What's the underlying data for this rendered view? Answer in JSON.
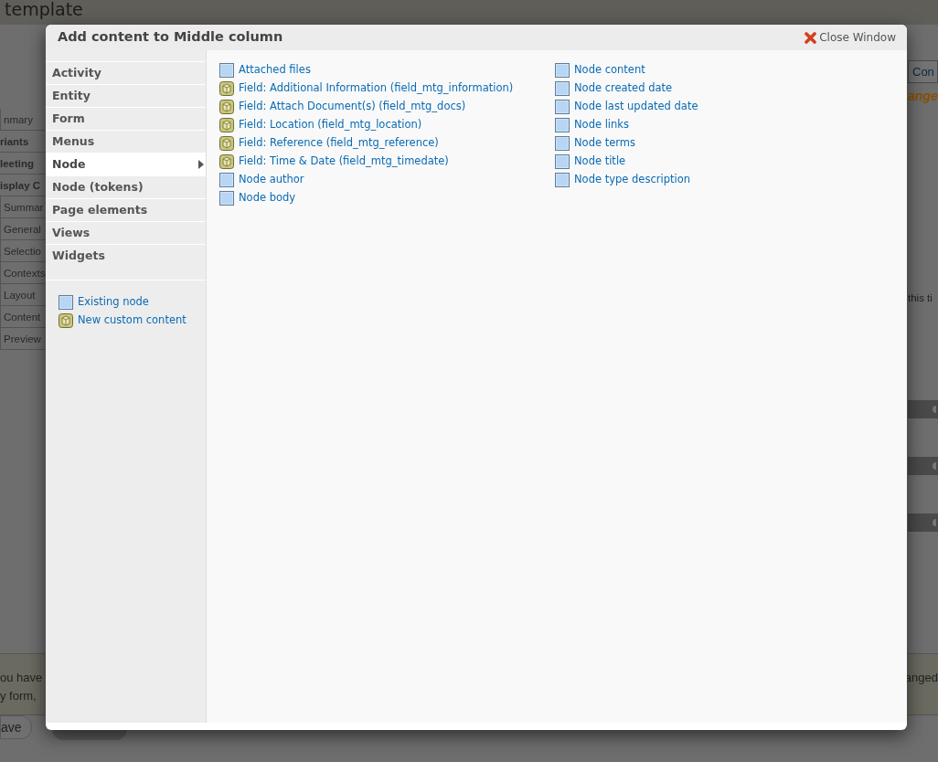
{
  "page": {
    "title": "template",
    "tabs": [
      {
        "label": "nmary",
        "kind": "tab"
      },
      {
        "label": "riants",
        "kind": "heading"
      },
      {
        "label": "leeting",
        "kind": "heading"
      },
      {
        "label": "isplay C",
        "kind": "heading"
      },
      {
        "label": "Summar",
        "kind": "tab"
      },
      {
        "label": "General",
        "kind": "tab"
      },
      {
        "label": "Selectio",
        "kind": "tab"
      },
      {
        "label": "Contexts",
        "kind": "tab"
      },
      {
        "label": "Layout",
        "kind": "tab"
      },
      {
        "label": "Content",
        "kind": "tab"
      },
      {
        "label": "Preview",
        "kind": "tab"
      }
    ],
    "right_button": "Con",
    "right_notice": "ange",
    "right_text": "this ti",
    "message_lines": [
      "ou have",
      "y form,"
    ],
    "message_right": "anged",
    "save_button": "ave"
  },
  "modal": {
    "title": "Add content to Middle column",
    "close": "Close Window",
    "categories": [
      {
        "label": "Activity",
        "selected": false
      },
      {
        "label": "Entity",
        "selected": false
      },
      {
        "label": "Form",
        "selected": false
      },
      {
        "label": "Menus",
        "selected": false
      },
      {
        "label": "Node",
        "selected": true
      },
      {
        "label": "Node (tokens)",
        "selected": false
      },
      {
        "label": "Page elements",
        "selected": false
      },
      {
        "label": "Views",
        "selected": false
      },
      {
        "label": "Widgets",
        "selected": false
      }
    ],
    "extra_links": [
      {
        "label": "Existing node",
        "kind": "page"
      },
      {
        "label": "New custom content",
        "kind": "box"
      }
    ],
    "columns": [
      [
        {
          "label": "Attached files",
          "kind": "page"
        },
        {
          "label": "Field: Additional Information (field_mtg_information)",
          "kind": "box"
        },
        {
          "label": "Field: Attach Document(s) (field_mtg_docs)",
          "kind": "box"
        },
        {
          "label": "Field: Location (field_mtg_location)",
          "kind": "box"
        },
        {
          "label": "Field: Reference (field_mtg_reference)",
          "kind": "box"
        },
        {
          "label": "Field: Time & Date (field_mtg_timedate)",
          "kind": "box"
        },
        {
          "label": "Node author",
          "kind": "page"
        },
        {
          "label": "Node body",
          "kind": "page"
        }
      ],
      [
        {
          "label": "Node content",
          "kind": "page"
        },
        {
          "label": "Node created date",
          "kind": "page"
        },
        {
          "label": "Node last updated date",
          "kind": "page"
        },
        {
          "label": "Node links",
          "kind": "page"
        },
        {
          "label": "Node terms",
          "kind": "page"
        },
        {
          "label": "Node title",
          "kind": "page"
        },
        {
          "label": "Node type description",
          "kind": "page"
        }
      ]
    ]
  }
}
